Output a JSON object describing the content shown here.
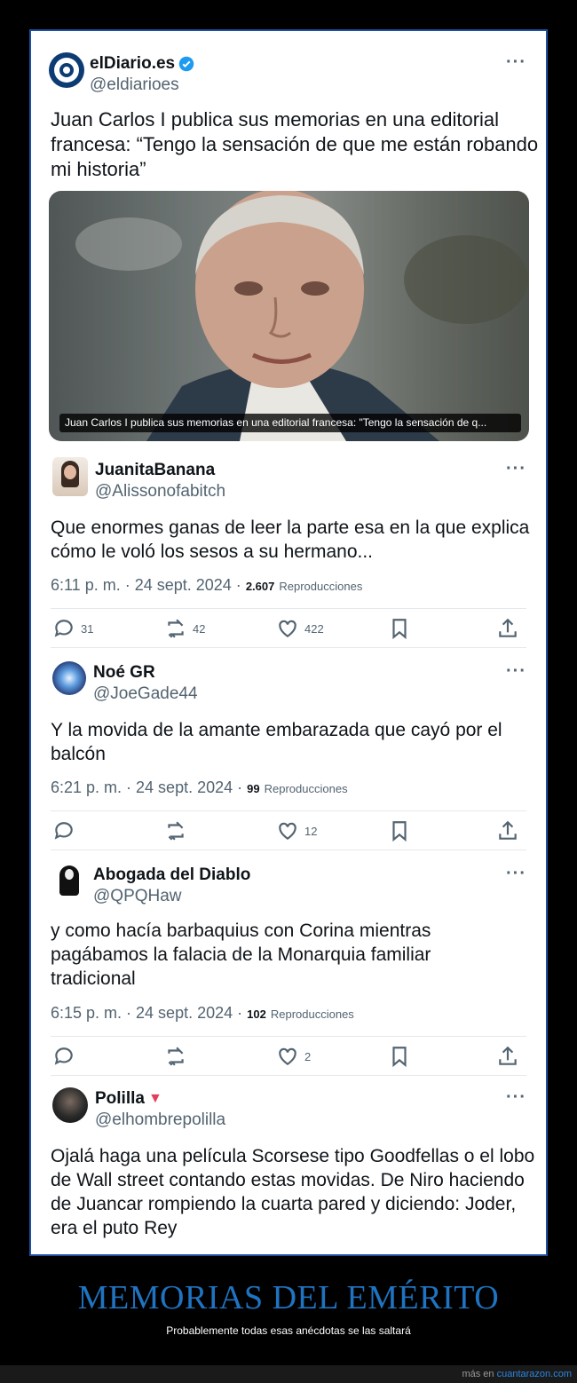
{
  "main_tweet": {
    "name": "elDiario.es",
    "handle": "@eldiarioes",
    "text": "Juan Carlos I publica sus memorias en una editorial francesa: “Tengo la sensación de que me están robando mi historia”",
    "image_caption": "Juan Carlos I publica sus memorias en una editorial francesa: \"Tengo la sensación de q...",
    "verified_color": "#1d9bf0",
    "more": "···"
  },
  "replies": [
    {
      "name": "JuanitaBanana",
      "handle": "@Alissonofabitch",
      "text": "Que enormes ganas de leer la parte esa en la que explica cómo le voló los sesos a su hermano...",
      "time": "6:11 p. m. · 24 sept. 2024 ·",
      "views": "2.607",
      "views_label": "Reproducciones",
      "replies_count": "31",
      "retweets_count": "42",
      "likes_count": "422",
      "more": "···"
    },
    {
      "name": "Noé GR",
      "handle": "@JoeGade44",
      "text": "Y la movida de la amante embarazada que cayó por el balcón",
      "time": "6:21 p. m. · 24 sept. 2024 ·",
      "views": "99",
      "views_label": "Reproducciones",
      "replies_count": "",
      "retweets_count": "",
      "likes_count": "12",
      "more": "···"
    },
    {
      "name": "Abogada del Diablo",
      "handle": "@QPQHaw",
      "text": "y como hacía barbaquius con Corina mientras pagábamos la falacia de la Monarquia familiar tradicional",
      "time": "6:15 p. m. · 24 sept. 2024 ·",
      "views": "102",
      "views_label": "Reproducciones",
      "replies_count": "",
      "retweets_count": "",
      "likes_count": "2",
      "more": "···"
    },
    {
      "name": "Polilla",
      "name_badge": "▼",
      "handle": "@elhombrepolilla",
      "text": "Ojalá haga una película Scorsese tipo Goodfellas o el lobo de Wall street contando estas movidas. De Niro haciendo de Juancar rompiendo la cuarta pared y diciendo: Joder, era el puto Rey",
      "more": "···"
    }
  ],
  "footer": {
    "title": "MEMORIAS DEL EMÉRITO",
    "subtitle": "Probablemente todas esas anécdotas se las saltará",
    "credit_prefix": "más en",
    "credit_link": "cuantarazon.com",
    "title_color": "#1f73c0"
  }
}
